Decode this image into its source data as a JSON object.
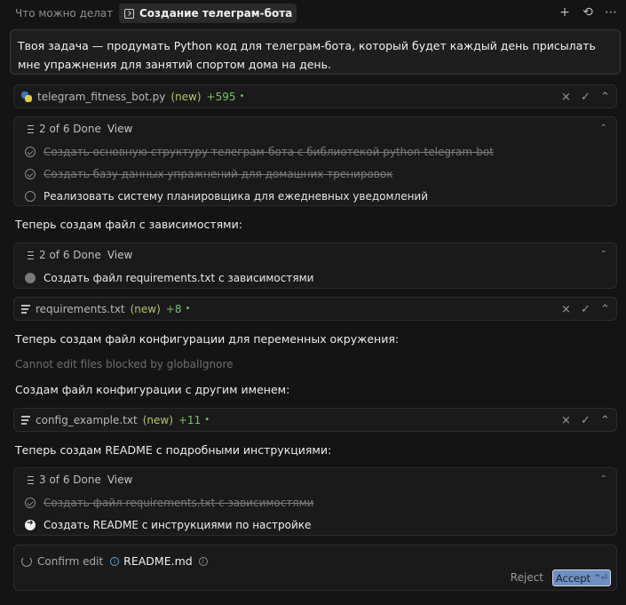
{
  "tabs": {
    "inactive_label": "Что можно делать",
    "active_label": "Создание телеграм-бота для у",
    "new_icon": "plus-icon",
    "history_icon": "history-icon",
    "more_icon": "more-icon"
  },
  "prompt": {
    "text": "Твоя задача — продумать Python код для телеграм-бота, который будет каждый день присылать мне упражнения для занятий спортом дома на день."
  },
  "files": [
    {
      "name": "telegram_fitness_bot.py",
      "status": "(new)",
      "changes": "+595",
      "icon": "python-file-icon"
    },
    {
      "name": "requirements.txt",
      "status": "(new)",
      "changes": "+8",
      "icon": "text-file-icon"
    },
    {
      "name": "config_example.txt",
      "status": "(new)",
      "changes": "+11",
      "icon": "text-file-icon"
    }
  ],
  "todo_lists": [
    {
      "progress": "2 of 6 Done",
      "view": "View",
      "items": [
        {
          "text": "Создать основную структуру телеграм-бота с библиотекой python-telegram-bot",
          "state": "done"
        },
        {
          "text": "Создать базу данных упражнений для домашних тренировок",
          "state": "done"
        },
        {
          "text": "Реализовать систему планировщика для ежедневных уведомлений",
          "state": "pending"
        }
      ]
    },
    {
      "progress": "2 of 6 Done",
      "view": "View",
      "items": [
        {
          "text": "Создать файл requirements.txt с зависимостями",
          "state": "in-progress"
        }
      ]
    },
    {
      "progress": "3 of 6 Done",
      "view": "View",
      "items": [
        {
          "text": "Создать файл requirements.txt с зависимостями",
          "state": "done"
        },
        {
          "text": "Создать README с инструкциями по настройке",
          "state": "next"
        }
      ]
    }
  ],
  "messages": {
    "deps": "Теперь создам файл с зависимостями:",
    "env_config": "Теперь создам файл конфигурации для переменных окружения:",
    "blocked": "Cannot edit files blocked by globalIgnore",
    "alt_config": "Создам файл конфигурации с другим именем:",
    "readme": "Теперь создам README с подробными инструкциями:"
  },
  "confirm": {
    "label": "Confirm edit",
    "file": "README.md",
    "reject": "Reject",
    "accept": "Accept",
    "accept_shortcut": "^⏎"
  },
  "colors": {
    "accent_accept": "#6f8fc0",
    "new_tag": "#b6c56a",
    "added_lines": "#79c36a"
  }
}
